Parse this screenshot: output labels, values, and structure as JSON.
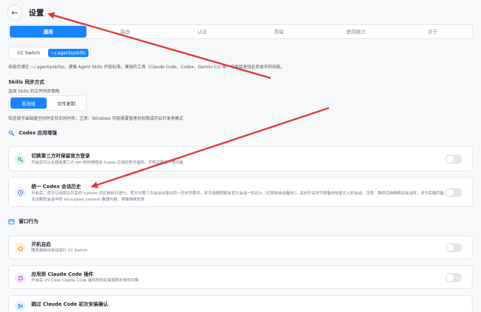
{
  "header": {
    "title": "设置",
    "back_glyph": "←"
  },
  "tabs": [
    {
      "label": "通用",
      "active": true
    },
    {
      "label": "路由",
      "active": false
    },
    {
      "label": "认证",
      "active": false
    },
    {
      "label": "高级",
      "active": false
    },
    {
      "label": "使用统计",
      "active": false
    },
    {
      "label": "关于",
      "active": false
    }
  ],
  "skills_dir": {
    "options": [
      "CC Switch",
      "~/.agents/skills"
    ],
    "selected": "~/.agents/skills",
    "description": "技能存储在 ~/.agents/skills/，遵循 Agent Skills 开放标准。兼容的工具（Claude Code、Codex、Gemini CLI 等）可直接发现此目录中的技能。"
  },
  "sync": {
    "title": "Skills 同步方式",
    "subtitle": "选择 Skills 的文件同步策略",
    "options": [
      "软连接",
      "文件复制"
    ],
    "selected": "软连接",
    "note": "软连接节省磁盘空间并支持实时同步。注意：Windows 可能需要管理员权限或开启开发者模式"
  },
  "codex_section": {
    "title": "Codex 应用增强",
    "icon": "key-icon",
    "items": [
      {
        "title": "切换第三方时保留官方登录",
        "desc": "开启后可以在使用第三方 API 的时候使用 Codex 应用的官方插件、手机远程操作等功能",
        "enabled": false,
        "icon": "key-icon"
      },
      {
        "title": "统一 Codex 会话历史",
        "desc": "开启后，官方订阅将以共享的 custom 供应商标识进行，官方与第三方会话出现在同一历史列表中，并可选择把既有官方会话一并迁入（迁移前自动备份）。关闭开关时可按备份恢复迁入的会话。注意：跨供应商继续旧会话时，对方后端可能无法解密会话中的 encrypted_content 推理内容，导致继续失败",
        "enabled": false,
        "icon": "history-icon"
      }
    ]
  },
  "window_section": {
    "title": "窗口行为",
    "icon": "window-icon",
    "items": [
      {
        "title": "开机自启",
        "desc": "随系统启动自动运行 CC Switch",
        "enabled": false,
        "icon": "power-icon"
      },
      {
        "title": "应用到 Claude Code 插件",
        "desc": "开启后 VS Code Claude Code 插件的供应商将随本软件切换",
        "enabled": false,
        "icon": "plugin-icon"
      },
      {
        "title": "跳过 Claude Code 初次安装确认",
        "desc": "",
        "enabled": false,
        "icon": "skip-icon"
      }
    ]
  },
  "colors": {
    "accent": "#1a84ff",
    "annotation": "#e53935"
  }
}
